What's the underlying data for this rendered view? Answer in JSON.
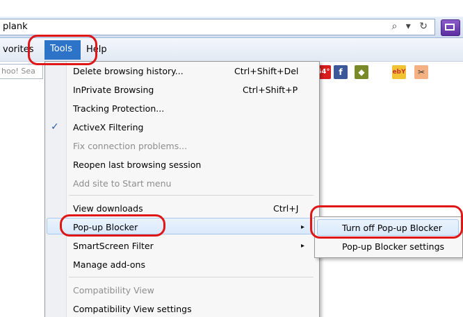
{
  "address_bar": {
    "url_text": "plank",
    "icons": [
      "search-dropdown-icon",
      "refresh-icon"
    ],
    "search_glyphs": "⌕ ▾ ↻"
  },
  "menu_bar": {
    "favorites_label": "vorites",
    "tools_label": "Tools",
    "help_label": "Help"
  },
  "toolbar": {
    "search_placeholder": "hoo! Sea",
    "badge_label": "54°",
    "icons": [
      "weather-icon",
      "facebook-icon",
      "game-icon",
      "ebay-icon",
      "scissors-icon"
    ]
  },
  "tools_menu": {
    "items": [
      {
        "label": "Delete browsing history...",
        "shortcut": "Ctrl+Shift+Del",
        "enabled": true
      },
      {
        "label": "InPrivate Browsing",
        "shortcut": "Ctrl+Shift+P",
        "enabled": true
      },
      {
        "label": "Tracking Protection...",
        "shortcut": "",
        "enabled": true
      },
      {
        "label": "ActiveX Filtering",
        "shortcut": "",
        "enabled": true,
        "checked": true
      },
      {
        "label": "Fix connection problems...",
        "shortcut": "",
        "enabled": false
      },
      {
        "label": "Reopen last browsing session",
        "shortcut": "",
        "enabled": true
      },
      {
        "label": "Add site to Start menu",
        "shortcut": "",
        "enabled": false
      },
      {
        "label": "View downloads",
        "shortcut": "Ctrl+J",
        "enabled": true
      },
      {
        "label": "Pop-up Blocker",
        "shortcut": "",
        "enabled": true,
        "submenu": true
      },
      {
        "label": "SmartScreen Filter",
        "shortcut": "",
        "enabled": true,
        "submenu": true
      },
      {
        "label": "Manage add-ons",
        "shortcut": "",
        "enabled": true
      },
      {
        "label": "Compatibility View",
        "shortcut": "",
        "enabled": false
      },
      {
        "label": "Compatibility View settings",
        "shortcut": "",
        "enabled": true
      }
    ],
    "check_glyph": "✓",
    "arrow_glyph": "▸"
  },
  "popup_submenu": {
    "items": [
      {
        "label": "Turn off Pop-up Blocker"
      },
      {
        "label": "Pop-up Blocker settings"
      }
    ]
  },
  "colors": {
    "menu_highlight": "#2d74c9",
    "annotation_red": "#e01616"
  }
}
